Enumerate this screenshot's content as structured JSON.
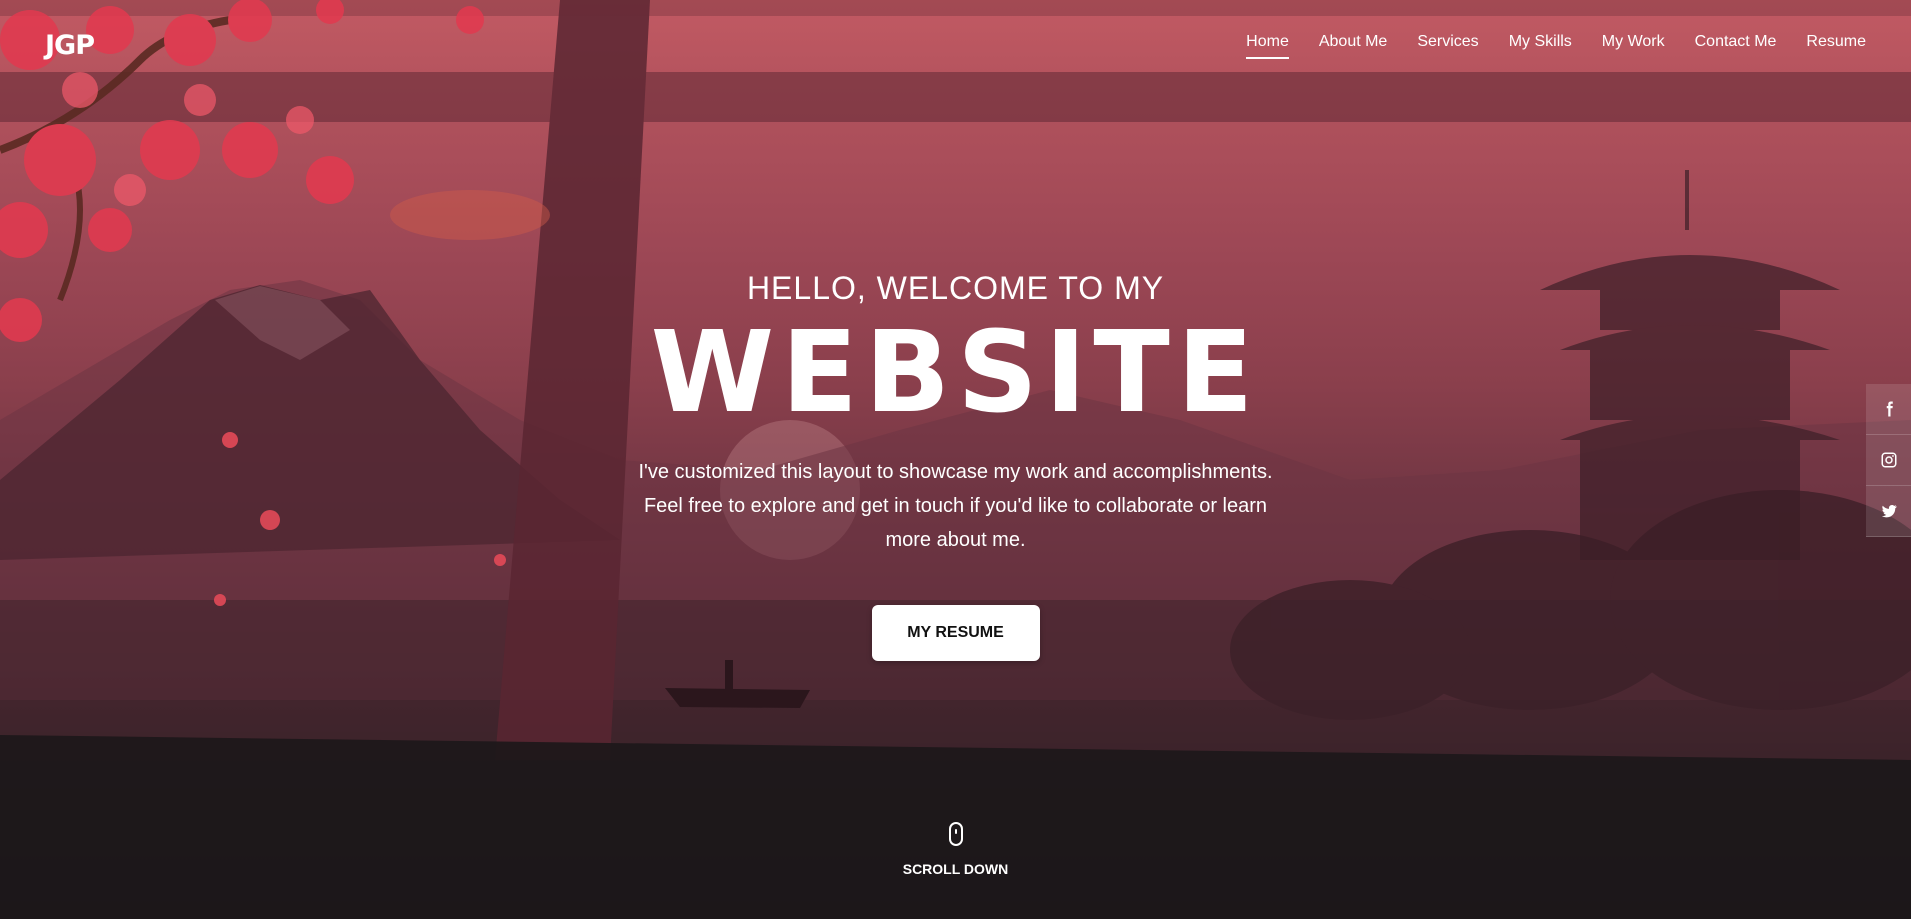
{
  "brand": {
    "logo_text": "JGP"
  },
  "nav": {
    "items": [
      {
        "label": "Home",
        "active": true
      },
      {
        "label": "About Me",
        "active": false
      },
      {
        "label": "Services",
        "active": false
      },
      {
        "label": "My Skills",
        "active": false
      },
      {
        "label": "My Work",
        "active": false
      },
      {
        "label": "Contact Me",
        "active": false
      },
      {
        "label": "Resume",
        "active": false
      }
    ]
  },
  "hero": {
    "kicker": "HELLO, WELCOME TO MY",
    "title": "WEBSITE",
    "description": "I've customized this layout to showcase my work and accomplishments. Feel free to explore and get in touch if you'd like to collaborate or learn more about me.",
    "button_label": "MY RESUME"
  },
  "scroll": {
    "label": "SCROLL DOWN",
    "icon": "mouse-icon"
  },
  "social": [
    {
      "icon": "facebook-icon"
    },
    {
      "icon": "instagram-icon"
    },
    {
      "icon": "twitter-icon"
    }
  ],
  "colors": {
    "overlay_top": "#c25a63",
    "overlay_bottom": "#1e1a1c",
    "button_bg": "#ffffff",
    "button_text": "#111111"
  }
}
